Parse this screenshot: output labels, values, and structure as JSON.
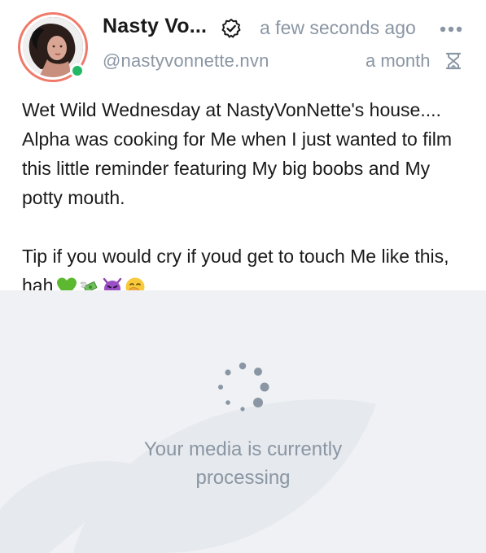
{
  "post": {
    "author": {
      "display_name": "Nasty Vo...",
      "username": "@nastyvonnette.nvn",
      "online": true,
      "verified": true
    },
    "timestamp": "a few seconds ago",
    "expiry": "a month",
    "text": {
      "line1": "Wet Wild Wednesday at NastyVonNette's house....",
      "line2": "Alpha was cooking for Me when I just wanted to film",
      "line3": "this little reminder featuring My big boobs and My",
      "line4": "potty mouth.",
      "line5": "Tip if you would cry if youd get to touch Me like this,",
      "line6": "hah"
    },
    "emojis": [
      "green-heart",
      "money-with-wings",
      "smiling-imp",
      "face-with-hand-over-mouth"
    ]
  },
  "media": {
    "status_line1": "Your media is currently",
    "status_line2": "processing"
  },
  "colors": {
    "accent_ring": "#f07a6a",
    "online": "#25b864",
    "muted_text": "#8a96a3",
    "media_bg": "#eff1f4"
  }
}
